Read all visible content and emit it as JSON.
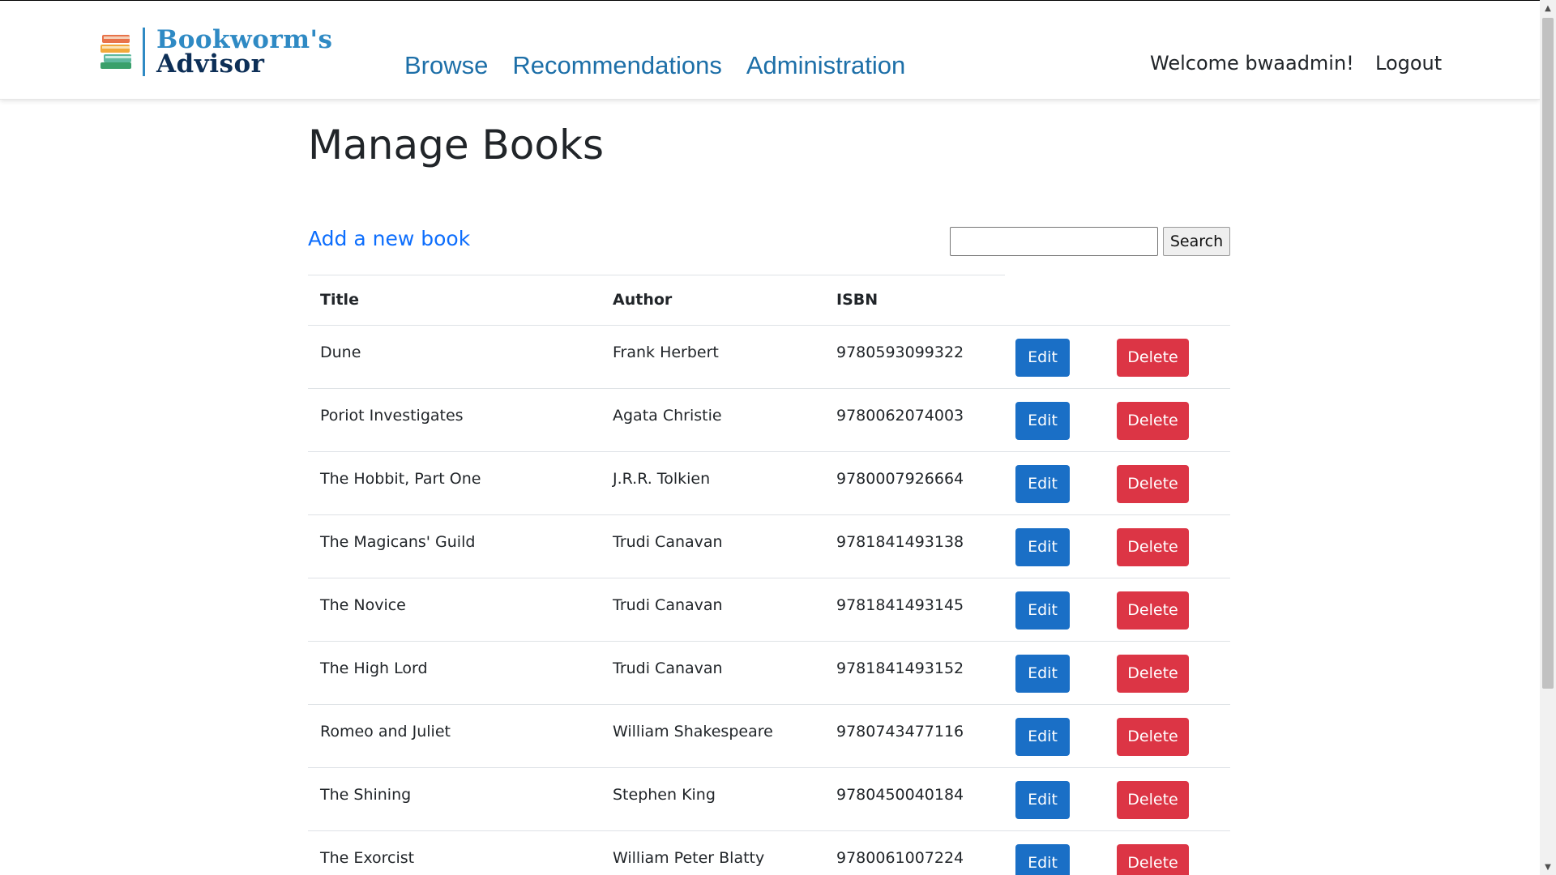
{
  "brand": {
    "line1": "Bookworm's",
    "line2": "Advisor",
    "icon": "stacked-books-icon"
  },
  "nav": {
    "items": [
      {
        "label": "Browse"
      },
      {
        "label": "Recommendations"
      },
      {
        "label": "Administration"
      }
    ],
    "welcome": "Welcome bwaadmin!",
    "logout": "Logout"
  },
  "main": {
    "title": "Manage Books",
    "add_link": "Add a new book",
    "search": {
      "value": "",
      "placeholder": "",
      "button": "Search"
    },
    "table": {
      "headers": {
        "title": "Title",
        "author": "Author",
        "isbn": "ISBN"
      },
      "edit_label": "Edit",
      "delete_label": "Delete",
      "rows": [
        {
          "title": "Dune",
          "author": "Frank Herbert",
          "isbn": "9780593099322",
          "edit": "Edit",
          "delete": "Delete"
        },
        {
          "title": "Poriot Investigates",
          "author": "Agata Christie",
          "isbn": "9780062074003",
          "edit": "Edit",
          "delete": "Delete"
        },
        {
          "title": "The Hobbit, Part One",
          "author": "J.R.R. Tolkien",
          "isbn": "9780007926664",
          "edit": "Edit",
          "delete": "Delete"
        },
        {
          "title": "The Magicans' Guild",
          "author": "Trudi Canavan",
          "isbn": "9781841493138",
          "edit": "Edit",
          "delete": "Delete"
        },
        {
          "title": "The Novice",
          "author": "Trudi Canavan",
          "isbn": "9781841493145",
          "edit": "Edit",
          "delete": "Delete"
        },
        {
          "title": "The High Lord",
          "author": "Trudi Canavan",
          "isbn": "9781841493152",
          "edit": "Edit",
          "delete": "Delete"
        },
        {
          "title": "Romeo and Juliet",
          "author": "William Shakespeare",
          "isbn": "9780743477116",
          "edit": "Edit",
          "delete": "Delete"
        },
        {
          "title": "The Shining",
          "author": "Stephen King",
          "isbn": "9780450040184",
          "edit": "Edit",
          "delete": "Delete"
        },
        {
          "title": "The Exorcist",
          "author": "William Peter Blatty",
          "isbn": "9780061007224",
          "edit": "Edit",
          "delete": "Delete"
        }
      ]
    }
  },
  "colors": {
    "nav_link": "#1d6fa8",
    "brand_light": "#2f8ac4",
    "brand_dark": "#0d2f57",
    "link": "#0d6efd",
    "edit_button": "#1a6fc6",
    "delete_button": "#dc3545"
  }
}
